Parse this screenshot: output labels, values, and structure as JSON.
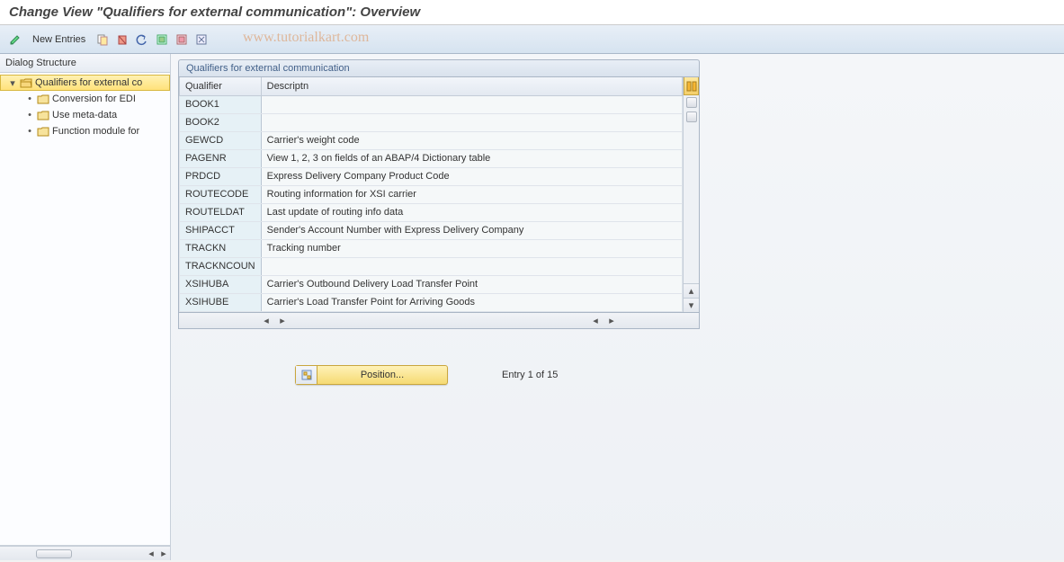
{
  "title": "Change View \"Qualifiers for external communication\": Overview",
  "watermark": "www.tutorialkart.com",
  "toolbar": {
    "new_entries": "New Entries"
  },
  "tree": {
    "header": "Dialog Structure",
    "root": {
      "label": "Qualifiers for external co"
    },
    "children": [
      {
        "label": "Conversion for EDI"
      },
      {
        "label": "Use meta-data"
      },
      {
        "label": "Function module for"
      }
    ]
  },
  "grid": {
    "caption": "Qualifiers for external communication",
    "columns": {
      "qualifier": "Qualifier",
      "description": "Descriptn"
    },
    "rows": [
      {
        "qualifier": "BOOK1",
        "description": ""
      },
      {
        "qualifier": "BOOK2",
        "description": ""
      },
      {
        "qualifier": "GEWCD",
        "description": "Carrier's weight code"
      },
      {
        "qualifier": "PAGENR",
        "description": "View 1, 2, 3 on fields of an ABAP/4 Dictionary table"
      },
      {
        "qualifier": "PRDCD",
        "description": "Express Delivery Company Product Code"
      },
      {
        "qualifier": "ROUTECODE",
        "description": "Routing information for XSI carrier"
      },
      {
        "qualifier": "ROUTELDAT",
        "description": "Last update of routing info data"
      },
      {
        "qualifier": "SHIPACCT",
        "description": "Sender's Account Number with Express Delivery Company"
      },
      {
        "qualifier": "TRACKN",
        "description": "Tracking number"
      },
      {
        "qualifier": "TRACKNCOUN",
        "description": ""
      },
      {
        "qualifier": "XSIHUBA",
        "description": "Carrier's Outbound Delivery Load Transfer Point"
      },
      {
        "qualifier": "XSIHUBE",
        "description": "Carrier's Load Transfer Point for Arriving Goods"
      }
    ]
  },
  "footer": {
    "position_label": "Position...",
    "entry_text": "Entry 1 of 15"
  }
}
